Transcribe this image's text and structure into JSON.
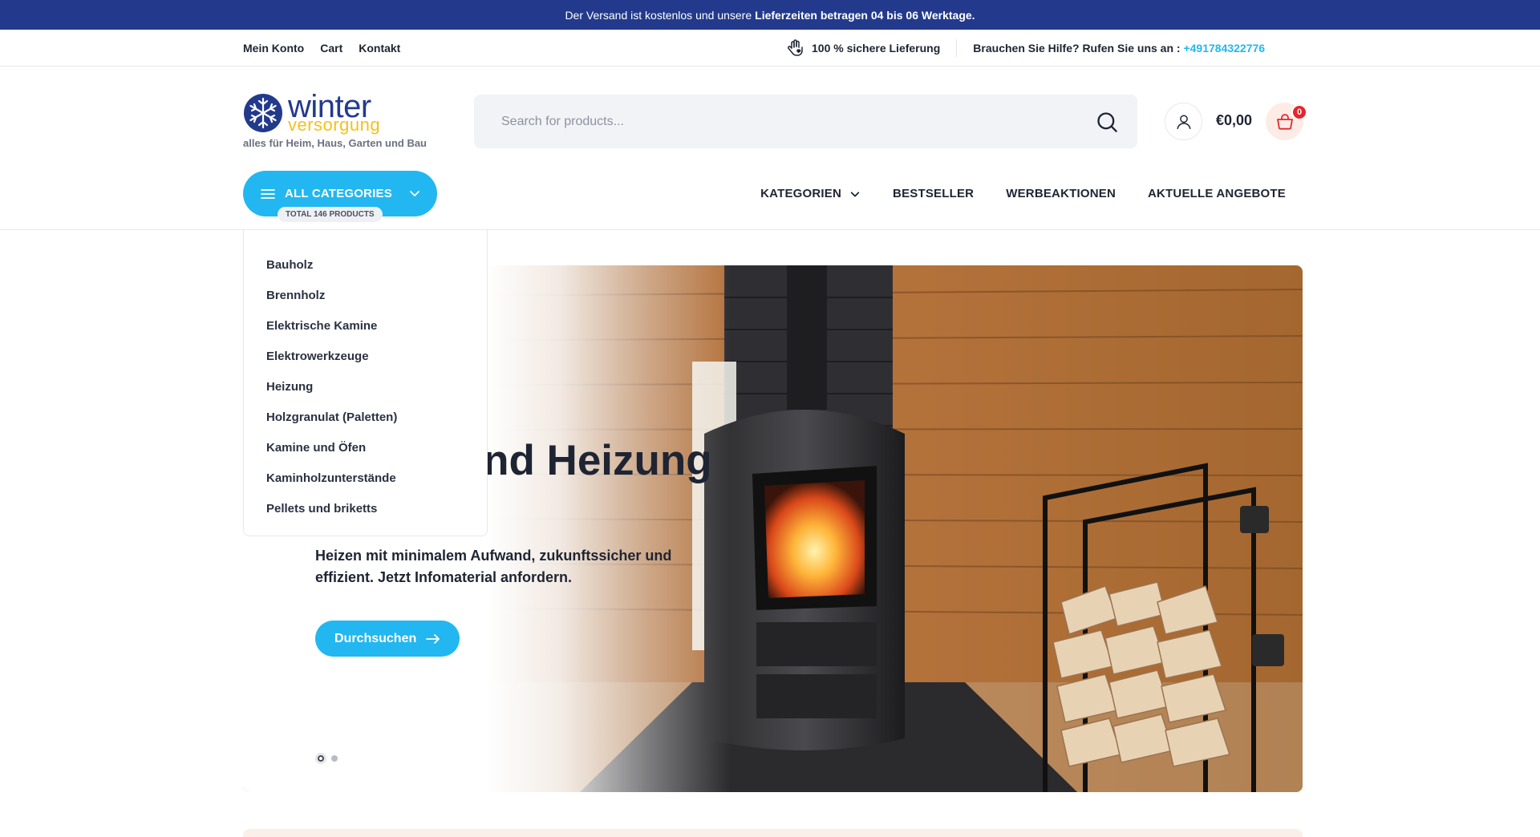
{
  "announcement": {
    "text": "Der Versand ist kostenlos und unsere",
    "bold": "Lieferzeiten betragen 04 bis 06 Werktage."
  },
  "utility": {
    "links": [
      "Mein Konto",
      "Cart",
      "Kontakt"
    ],
    "delivery": "100 % sichere Lieferung",
    "help_label": "Brauchen Sie Hilfe? Rufen Sie uns an :",
    "phone": "+491784322776"
  },
  "logo": {
    "word1": "winter",
    "word2": "versorgung",
    "tagline": "alles für Heim, Haus, Garten und Bau"
  },
  "search": {
    "placeholder": "Search for products..."
  },
  "cart": {
    "total": "€0,00",
    "count": "0"
  },
  "all_categories": {
    "label": "ALL CATEGORIES",
    "total": "TOTAL 146 PRODUCTS"
  },
  "nav": [
    "KATEGORIEN",
    "BESTSELLER",
    "WERBEAKTIONEN",
    "AKTUELLE ANGEBOTE"
  ],
  "categories": [
    "Bauholz",
    "Brennholz",
    "Elektrische Kamine",
    "Elektrowerkzeuge",
    "Heizung",
    "Holzgranulat (Paletten)",
    "Kamine und Öfen",
    "Kaminholzunterstände",
    "Pellets und briketts"
  ],
  "hero": {
    "title": "Kamin und Heizung",
    "subtitle": "Heizen mit minimalem Aufwand, zukunftssicher und effizient. Jetzt Infomaterial anfordern.",
    "button": "Durchsuchen"
  },
  "colors": {
    "primary": "#233a8c",
    "accent": "#22b7f0",
    "logo_yellow": "#f2c21b",
    "badge_red": "#e6262c"
  }
}
